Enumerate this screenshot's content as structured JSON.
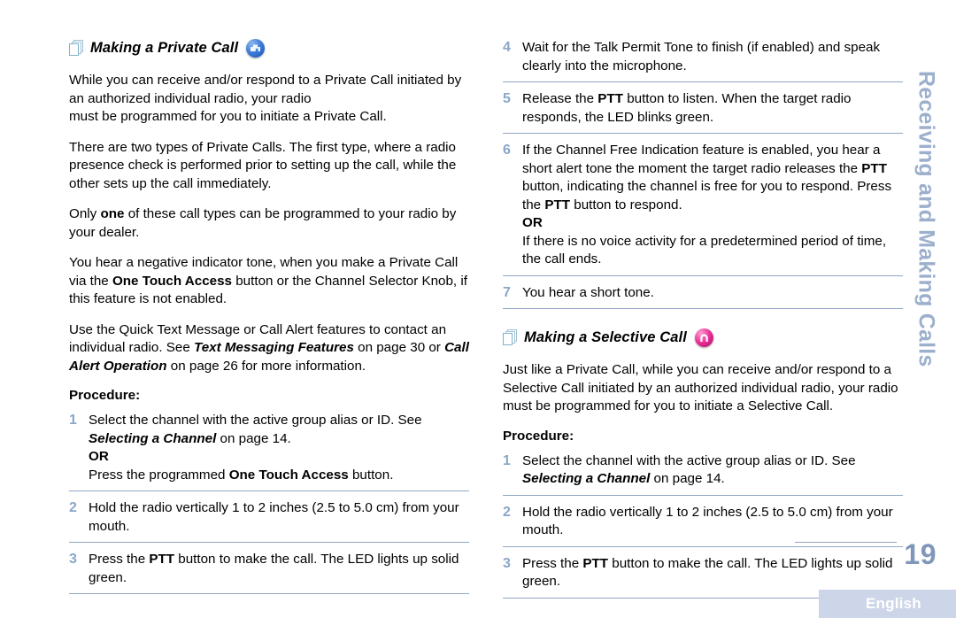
{
  "page": {
    "number": "19",
    "footer_language": "English",
    "side_tab": "Receiving and Making Calls",
    "colors": {
      "rule": "#93a6c6",
      "step_number": "#8ba6c9",
      "side_tab_text": "#9cb0cd",
      "folio": "#8197ba",
      "footer_band": "#ccd6e8",
      "private_call_icon": "#3f7fdc",
      "selective_call_icon": "#ec2f96"
    }
  },
  "left_column": {
    "heading": {
      "icon": "stacked-pages-icon",
      "title": "Making a Private Call",
      "feature_icon": "private-call-icon"
    },
    "paragraphs": [
      "While you can receive and/or respond to a Private Call initiated by an authorized individual radio, your radio must be programmed for you to initiate a Private Call.",
      "There are two types of Private Calls. The first type, where a radio presence check is performed prior to setting up the call, while the other sets up the call immediately.",
      "Only one of these call types can be programmed to your radio by your dealer.",
      "You hear a negative indicator tone, when you make a Private Call via the One Touch Access button or the Channel Selector Knob, if this feature is not enabled.",
      "Use the Quick Text Message or Call Alert features to contact an individual radio. See Text Messaging Features on page 30 or Call Alert Operation on page 26 for more information."
    ],
    "procedure_label": "Procedure:",
    "steps": [
      {
        "number": "1",
        "text": "Select the channel with the active group alias or ID. See Selecting a Channel on page 14. OR Press the programmed One Touch Access button."
      },
      {
        "number": "2",
        "text": "Hold the radio vertically 1 to 2 inches (2.5 to 5.0 cm) from your mouth."
      },
      {
        "number": "3",
        "text": "Press the PTT button to make the call. The LED lights up solid green."
      }
    ]
  },
  "right_column": {
    "continued_steps": [
      {
        "number": "4",
        "text": "Wait for the Talk Permit Tone to finish (if enabled) and speak clearly into the microphone."
      },
      {
        "number": "5",
        "text": "Release the PTT button to listen. When the target radio responds, the LED blinks green."
      },
      {
        "number": "6",
        "text": "If the Channel Free Indication feature is enabled, you hear a short alert tone the moment the target radio releases the PTT button, indicating the channel is free for you to respond. Press the PTT button to respond. OR If there is no voice activity for a predetermined period of time, the call ends."
      },
      {
        "number": "7",
        "text": "You hear a short tone."
      }
    ],
    "heading": {
      "icon": "stacked-pages-icon",
      "title": "Making a Selective Call",
      "feature_icon": "selective-call-icon"
    },
    "intro": "Just like a Private Call, while you can receive and/or respond to a Selective Call initiated by an authorized individual radio, your radio must be programmed for you to initiate a Selective Call.",
    "procedure_label": "Procedure:",
    "steps": [
      {
        "number": "1",
        "text": "Select the channel with the active group alias or ID. See Selecting a Channel on page 14."
      },
      {
        "number": "2",
        "text": "Hold the radio vertically 1 to 2 inches (2.5 to 5.0 cm) from your mouth."
      },
      {
        "number": "3",
        "text": "Press the PTT button to make the call. The LED lights up solid green."
      }
    ]
  },
  "rich_text": {
    "l_p1_a": "While you can receive and/or respond to a Private Call initiated by an authorized individual radio, your radio",
    "l_p1_b": "must be programmed for you to initiate a Private Call.",
    "l_p2": "There are two types of Private Calls. The first type, where a radio presence check is performed prior to setting up the call, while the other sets up the call immediately.",
    "l_p3_a": "Only ",
    "l_p3_b": "one",
    "l_p3_c": " of these call types can be programmed to your radio by your dealer.",
    "l_p4_a": "You hear a negative indicator tone, when you make a Private Call via the ",
    "l_p4_b": "One Touch Access",
    "l_p4_c": " button or the Channel Selector Knob, if this feature is not enabled.",
    "l_p5_a": "Use the Quick Text Message or Call Alert features to contact an individual radio. See ",
    "l_p5_b": "Text Messaging Features",
    "l_p5_c": " on page 30 or ",
    "l_p5_d": "Call Alert Operation",
    "l_p5_e": " on page 26 for more information.",
    "l_s1_a": "Select the channel with the active group alias or ID. See ",
    "l_s1_b": "Selecting a Channel",
    "l_s1_c": " on page 14.",
    "l_s1_or": "OR",
    "l_s1_d": "Press the programmed ",
    "l_s1_e": "One Touch Access",
    "l_s1_f": " button.",
    "l_s2": "Hold the radio vertically 1 to 2 inches (2.5 to 5.0 cm) from your mouth.",
    "l_s3_a": "Press the ",
    "l_s3_b": "PTT",
    "l_s3_c": " button to make the call. The LED lights up solid green.",
    "r_s4": "Wait for the Talk Permit Tone to finish (if enabled) and speak clearly into the microphone.",
    "r_s5_a": "Release the ",
    "r_s5_b": "PTT",
    "r_s5_c": " button to listen. When the target radio responds, the LED blinks green.",
    "r_s6_a": "If the Channel Free Indication feature is enabled, you hear a short alert tone the moment the target radio releases the ",
    "r_s6_b": "PTT",
    "r_s6_c": " button, indicating the channel is free for you to respond. Press the ",
    "r_s6_d": "PTT",
    "r_s6_e": " button to respond.",
    "r_s6_or": "OR",
    "r_s6_f": "If there is no voice activity for a predetermined period of time, the call ends.",
    "r_s7": "You hear a short tone.",
    "r_intro": "Just like a Private Call, while you can receive and/or respond to a Selective Call initiated by an authorized individual radio, your radio must be programmed for you to initiate a Selective Call.",
    "r_s1_a": "Select the channel with the active group alias or ID. See ",
    "r_s1_b": "Selecting a Channel",
    "r_s1_c": " on page 14.",
    "r_s2": "Hold the radio vertically 1 to 2 inches (2.5 to 5.0 cm) from your mouth.",
    "r_s3_a": "Press the ",
    "r_s3_b": "PTT",
    "r_s3_c": " button to make the call. The LED lights up solid green."
  }
}
